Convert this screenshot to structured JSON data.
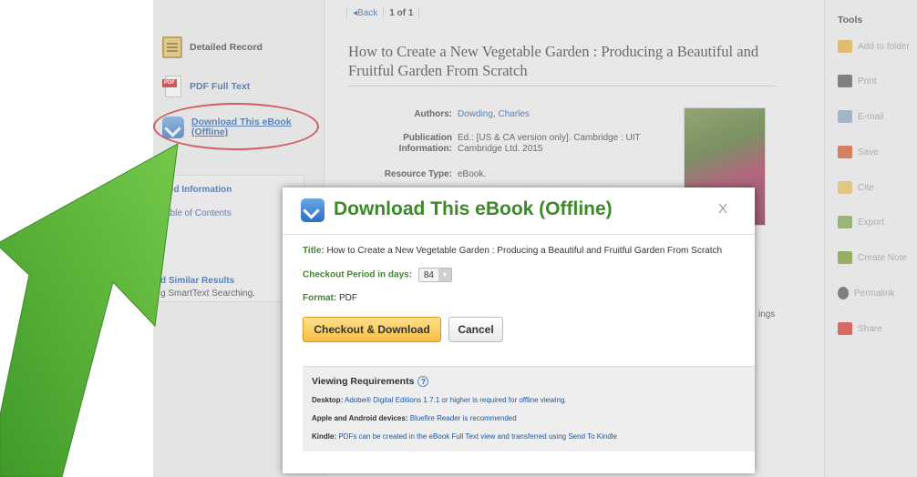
{
  "nav": {
    "back_label": "Back",
    "page_label": "1 of 1"
  },
  "left_nav": {
    "detailed_record": "Detailed Record",
    "pdf_full_text": "PDF Full Text",
    "download_line1": "Download This eBook",
    "download_line2": "(Offline)",
    "pdf_badge": "PDF",
    "related_heading": "ated Information",
    "table_of_contents": "Table of Contents",
    "similar_heading": "d Similar Results",
    "similar_sub": "g SmartText Searching."
  },
  "record": {
    "title": "How to Create a New Vegetable Garden : Producing a Beautiful and Fruitful Garden From Scratch",
    "authors_label": "Authors:",
    "authors_value": "Dowding, Charles",
    "pub_label_1": "Publication",
    "pub_label_2": "Information:",
    "pub_value_1": "Ed.: [US & CA version only]. Cambridge : UIT",
    "pub_value_2": "Cambridge Ltd. 2015",
    "type_label": "Resource Type:",
    "type_value": "eBook.",
    "partial_text": "ings"
  },
  "tools": {
    "title": "Tools",
    "items": [
      {
        "label": "Add to folder",
        "icon": "folder-icon",
        "color": "#e8b23a"
      },
      {
        "label": "Print",
        "icon": "print-icon",
        "color": "#555555"
      },
      {
        "label": "E-mail",
        "icon": "email-icon",
        "color": "#8aa6c8"
      },
      {
        "label": "Save",
        "icon": "save-icon",
        "color": "#d9542c"
      },
      {
        "label": "Cite",
        "icon": "cite-icon",
        "color": "#e8c25a"
      },
      {
        "label": "Export",
        "icon": "export-icon",
        "color": "#7aa54a"
      },
      {
        "label": "Create Note",
        "icon": "note-icon",
        "color": "#7a9a2a"
      },
      {
        "label": "Permalink",
        "icon": "link-icon",
        "color": "#555555"
      },
      {
        "label": "Share",
        "icon": "share-icon",
        "color": "#d9342c"
      }
    ]
  },
  "modal": {
    "title": "Download This eBook (Offline)",
    "close_label": "X",
    "title_label": "Title:",
    "title_value": "How to Create a New Vegetable Garden : Producing a Beautiful and Fruitful Garden From Scratch",
    "period_label": "Checkout Period in days:",
    "period_value": "84",
    "format_label": "Format:",
    "format_value": "PDF",
    "checkout_button": "Checkout & Download",
    "cancel_button": "Cancel",
    "requirements": {
      "heading": "Viewing Requirements",
      "help_glyph": "?",
      "desktop_label": "Desktop:",
      "desktop_value": "Adobe® Digital Editions 1.7.1 or higher is required for offline viewing.",
      "mobile_label": "Apple and Android devices:",
      "mobile_value": "Bluefire Reader is recommended",
      "kindle_label": "Kindle:",
      "kindle_value": "PDFs can be created in the eBook Full Text view and transferred using Send To Kindle"
    }
  },
  "colors": {
    "accent_green": "#3c8a27",
    "link_blue": "#1d57a6",
    "annotation_red": "#d0212a",
    "arrow_green": "#5cb33a"
  }
}
